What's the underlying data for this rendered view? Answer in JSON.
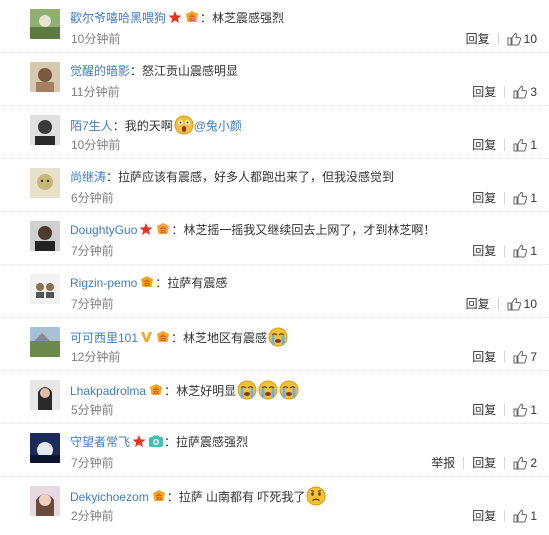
{
  "comments": [
    {
      "username": "歡尔爷嘻哈黑喂狗",
      "badges": [
        "star-badge",
        "vip-badge"
      ],
      "text": "：林芝震感强烈",
      "time": "10分钟前",
      "report": "",
      "reply": "回复",
      "likes": "10",
      "avatar_color": "#6b8a55"
    },
    {
      "username": "觉醒的暗影",
      "badges": [],
      "text": "：怒江贡山震感明显",
      "time": "11分钟前",
      "report": "",
      "reply": "回复",
      "likes": "3",
      "avatar_color": "#b89a78"
    },
    {
      "username": "陌7生人",
      "badges": [],
      "text": "：我的天啊",
      "mention": "@兔小颜",
      "time": "10分钟前",
      "report": "",
      "reply": "回复",
      "likes": "1",
      "avatar_color": "#6a6a6a"
    },
    {
      "username": "尚继涛",
      "badges": [],
      "text": "：拉萨应该有震感，好多人都跑出来了，但我没感觉到",
      "time": "6分钟前",
      "report": "",
      "reply": "回复",
      "likes": "1",
      "avatar_color": "#c9b98a"
    },
    {
      "username": "DoughtyGuo",
      "badges": [
        "star-badge",
        "vip-badge"
      ],
      "text": "：林芝摇一摇我又继续回去上网了，才到林芝啊！",
      "time": "7分钟前",
      "report": "",
      "reply": "回复",
      "likes": "1",
      "avatar_color": "#3d3d3d"
    },
    {
      "username": "Rigzin-pemo",
      "badges": [
        "vip-badge"
      ],
      "text": "：拉萨有震感",
      "time": "7分钟前",
      "report": "",
      "reply": "回复",
      "likes": "10",
      "avatar_color": "#dcdcdc"
    },
    {
      "username": "可可西里101",
      "badges": [
        "v-badge",
        "vip-badge"
      ],
      "text": "：林芝地区有震感",
      "time": "12分钟前",
      "report": "",
      "reply": "回复",
      "likes": "7",
      "avatar_color": "#8a9a6a"
    },
    {
      "username": "Lhakpadrolma",
      "badges": [
        "vip-badge"
      ],
      "text": "：林芝好明显",
      "time": "5分钟前",
      "report": "",
      "reply": "回复",
      "likes": "1",
      "avatar_color": "#4a4a4a"
    },
    {
      "username": "守望者常飞",
      "badges": [
        "star-badge",
        "camera-badge"
      ],
      "text": "：拉萨震感强烈",
      "time": "7分钟前",
      "report": "举报",
      "reply": "回复",
      "likes": "2",
      "avatar_color": "#2a3a6a"
    },
    {
      "username": "Dekyichoezom",
      "badges": [
        "vip-badge"
      ],
      "text": "：拉萨 山南都有 吓死我了",
      "time": "2分钟前",
      "report": "",
      "reply": "回复",
      "likes": "1",
      "avatar_color": "#d4b8a8"
    }
  ],
  "colors": {
    "username_blue": "#3f7cbf",
    "username_orange": "#eb7350",
    "time_gray": "#808080"
  },
  "icons": {
    "like": "thumbs-up-icon",
    "surprised": "surprised-face-icon",
    "crying": "crying-face-icon",
    "worried": "worried-face-icon"
  }
}
